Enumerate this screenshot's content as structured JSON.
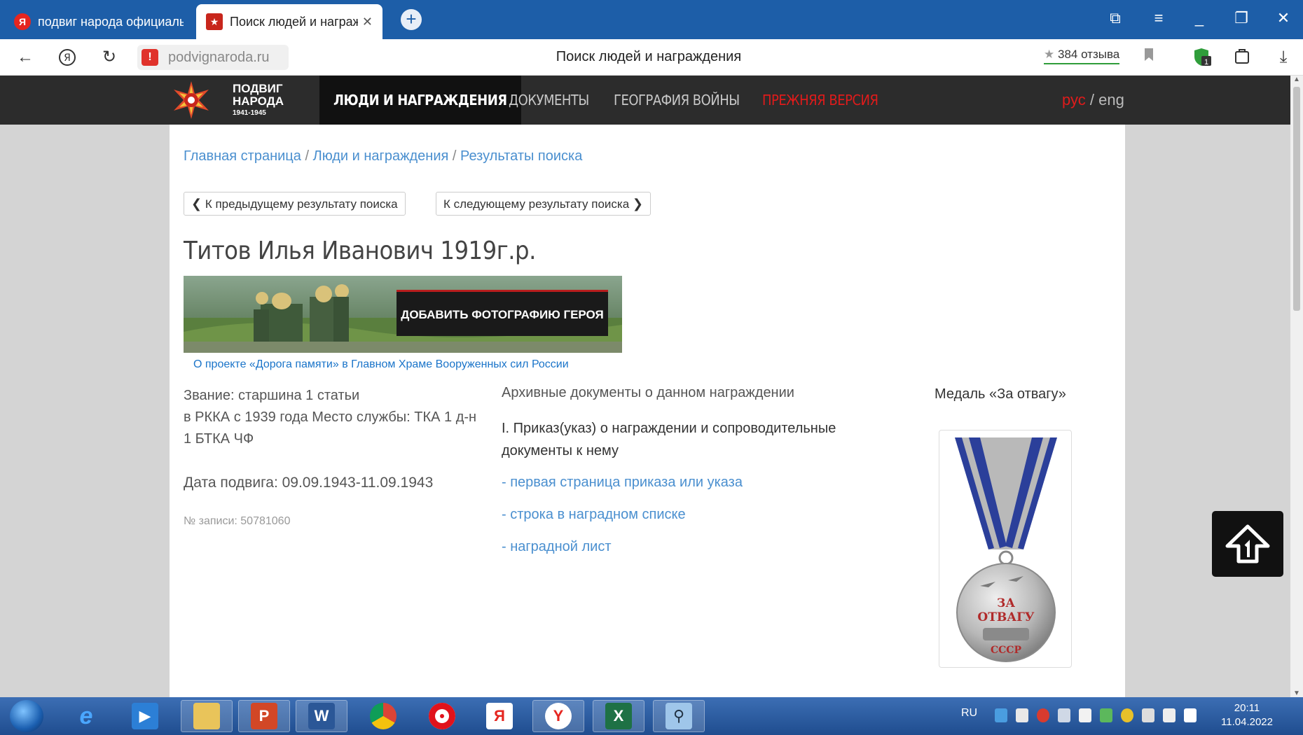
{
  "browser": {
    "tabs": [
      {
        "label": "подвиг народа официаль",
        "favicon": "yandex-icon",
        "active": false
      },
      {
        "label": "Поиск людей и награж",
        "favicon": "podvig-favicon",
        "active": true
      }
    ],
    "close_symbol": "✕",
    "new_tab_symbol": "+",
    "url_host": "podvignaroda.ru",
    "page_title": "Поиск людей и награждения",
    "reviews": "384 отзыва",
    "accent": "#1d5ea8"
  },
  "site": {
    "logo": {
      "line1": "ПОДВИГ",
      "line2": "НАРОДА",
      "years": "1941-1945"
    },
    "menu": [
      {
        "label": "ЛЮДИ И НАГРАЖДЕНИЯ",
        "active": true
      },
      {
        "label": "ДОКУМЕНТЫ",
        "active": false
      },
      {
        "label": "ГЕОГРАФИЯ ВОЙНЫ",
        "active": false
      },
      {
        "label": "ПРЕЖНЯЯ ВЕРСИЯ",
        "active": false,
        "color": "#e01b1b"
      }
    ],
    "lang": {
      "ru": "рус",
      "sep": "/",
      "en": "eng"
    }
  },
  "breadcrumb": {
    "items": [
      "Главная страница",
      "Люди и награждения",
      "Результаты поиска"
    ],
    "sep": "/"
  },
  "pager": {
    "prev": "К предыдущему результату поиска",
    "next": "К следующему результату поиска"
  },
  "person": {
    "name": "Титов Илья Иванович 1919г.р.",
    "rank": "Звание: старшина 1 статьи",
    "service": "в РККА с 1939 года Место службы: ТКА 1 д-н 1 БТКА ЧФ",
    "feat_date": "Дата подвига: 09.09.1943-11.09.1943",
    "record_no": "№ записи: 50781060"
  },
  "banner": {
    "button": "ДОБАВИТЬ ФОТОГРАФИЮ ГЕРОЯ",
    "link": "О проекте «Дорога памяти» в Главном Храме Вооруженных сил России"
  },
  "documents": {
    "heading": "Архивные документы о данном награждении",
    "order": "I. Приказ(указ) о награждении и сопроводительные документы к нему",
    "links": [
      "- первая страница приказа или указа",
      "- строка в наградном списке",
      "- наградной лист"
    ]
  },
  "medal": {
    "name": "Медаль «За отвагу»",
    "inscription": [
      "ЗА",
      "ОТВАГУ",
      "СССР"
    ]
  },
  "taskbar": {
    "apps": [
      "ie-icon",
      "media-player-icon",
      "file-explorer-icon",
      "powerpoint-icon",
      "word-icon",
      "chrome-icon",
      "opera-icon",
      "yandex-icon",
      "yandex-browser-icon",
      "excel-icon",
      "search-tool-icon"
    ],
    "lang": "RU",
    "time": "20:11",
    "date": "11.04.2022"
  }
}
